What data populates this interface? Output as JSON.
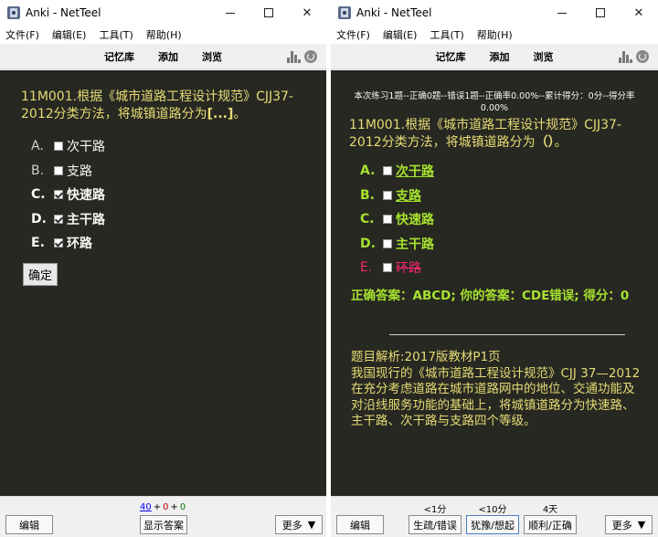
{
  "window": {
    "title": "Anki - NetTeel",
    "min_icon": "minimize-icon",
    "max_icon": "maximize-icon",
    "close_symbol": "✕"
  },
  "menu": [
    "文件(F)",
    "编辑(E)",
    "工具(T)",
    "帮助(H)"
  ],
  "toolbar": {
    "decks": "记忆库",
    "add": "添加",
    "browse": "浏览"
  },
  "front": {
    "question_prefix": "11M001.根据《城市道路工程设计规范》CJJ37-2012分类方法，将城镇道路分为",
    "cloze": "[...]",
    "question_suffix": "。",
    "options": [
      {
        "letter": "A.",
        "text": "次干路",
        "checked": false
      },
      {
        "letter": "B.",
        "text": "支路",
        "checked": false
      },
      {
        "letter": "C.",
        "text": "快速路",
        "checked": true
      },
      {
        "letter": "D.",
        "text": "主干路",
        "checked": true
      },
      {
        "letter": "E.",
        "text": "环路",
        "checked": true
      }
    ],
    "confirm": "确定"
  },
  "back": {
    "stats": "本次练习1题--正确0题--错误1题--正确率0.00%--累计得分：0分--得分率0.00%",
    "question_prefix": "11M001.根据《城市道路工程设计规范》CJJ37-2012分类方法，将城镇道路分为",
    "paren": "（）",
    "question_suffix": "。",
    "options": [
      {
        "letter": "A.",
        "text": "次干路"
      },
      {
        "letter": "B.",
        "text": "支路"
      },
      {
        "letter": "C.",
        "text": "快速路"
      },
      {
        "letter": "D.",
        "text": "主干路"
      },
      {
        "letter": "E.",
        "text": "环路"
      }
    ],
    "result": "正确答案：ABCD; 你的答案：CDE错误; 得分：0",
    "explain_title": "题目解析:2017版教材P1页",
    "explain_body": "我国现行的《城市道路工程设计规范》CJJ 37—2012在充分考虑道路在城市道路网中的地位、交通功能及对沿线服务功能的基础上，将城镇道路分为快速路、主干路、次干路与支路四个等级。"
  },
  "bottom_left": {
    "edit": "编辑",
    "count_new": "40",
    "count_learn": "0",
    "count_review": "0",
    "plus": "+",
    "show_answer": "显示答案",
    "more": "更多",
    "more_arrow": "▼"
  },
  "bottom_right": {
    "edit": "编辑",
    "ease": [
      {
        "time": "<1分",
        "label": "生疏/错误"
      },
      {
        "time": "<10分",
        "label": "犹豫/想起"
      },
      {
        "time": "4天",
        "label": "顺利/正确"
      }
    ],
    "more": "更多",
    "more_arrow": "▼"
  }
}
